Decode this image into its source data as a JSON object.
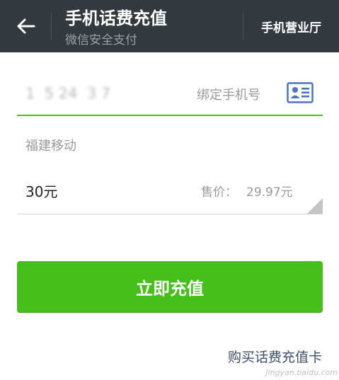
{
  "header": {
    "title": "手机话费充值",
    "subtitle": "微信安全支付",
    "hall_link": "手机营业厅",
    "background": "#333a3f"
  },
  "icons": {
    "back": "arrow-left-icon",
    "contacts": "contact-card-icon"
  },
  "phone": {
    "value": "1  5 24  3 7",
    "label": "绑定手机号"
  },
  "carrier": "福建移动",
  "amount": {
    "value": "30元",
    "price_label": "售价：",
    "price_value": "29.97元"
  },
  "pay_button": {
    "label": "立即充值"
  },
  "buy_card_link": "购买话费充值卡",
  "watermark": "Jingyan.baidu.com",
  "colors": {
    "accent": "#45c01a",
    "contact_icon": "#4a74c6",
    "link": "#3e4f6b"
  }
}
